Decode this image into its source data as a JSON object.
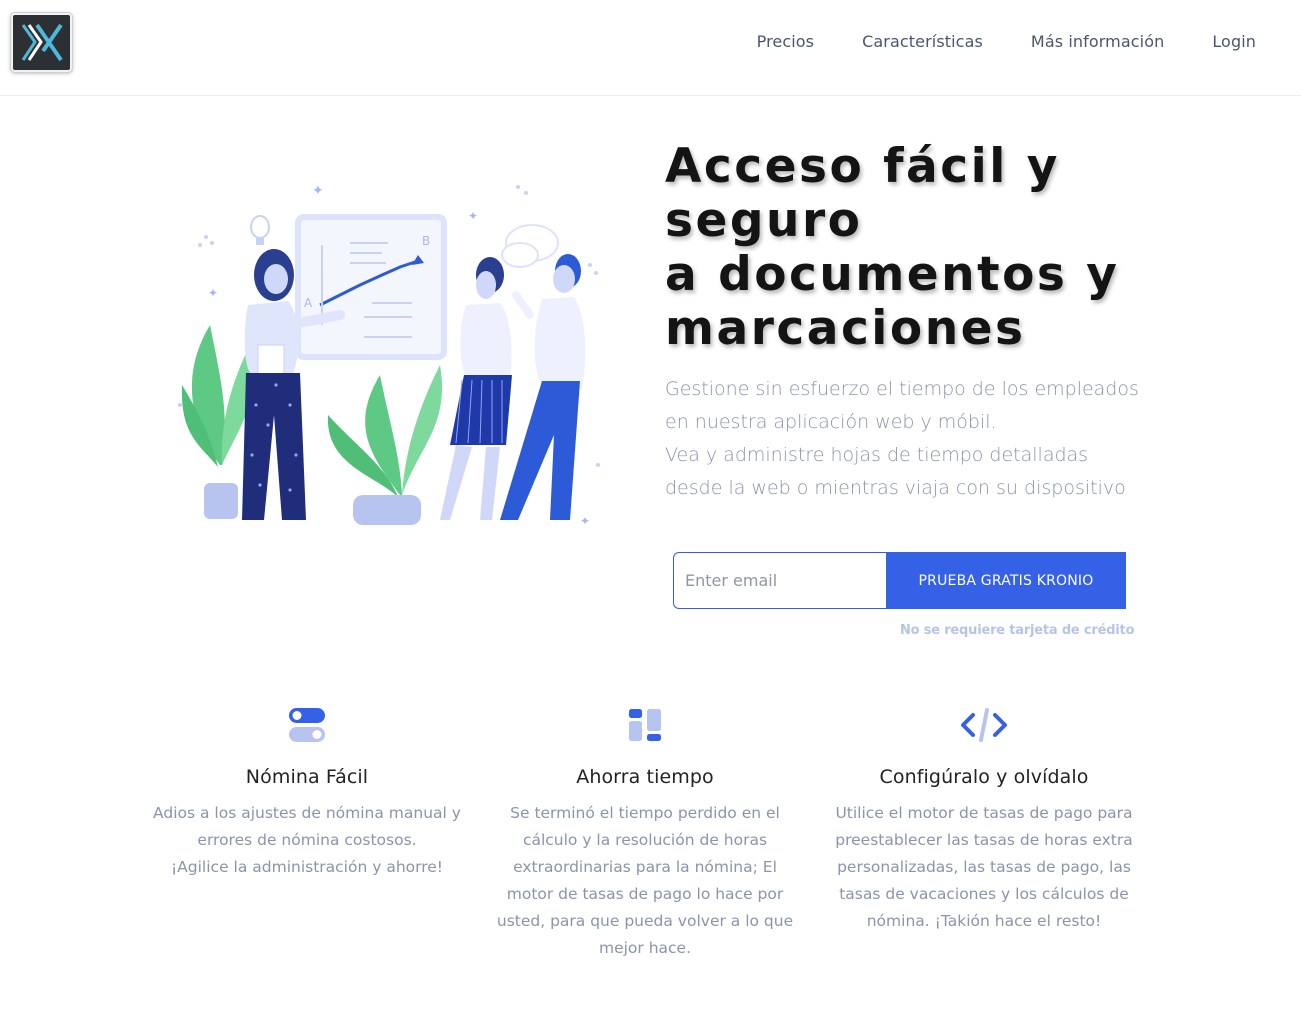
{
  "header": {
    "nav": [
      {
        "label": "Precios"
      },
      {
        "label": "Características"
      },
      {
        "label": "Más información"
      },
      {
        "label": "Login"
      }
    ]
  },
  "hero": {
    "title_lines": [
      "Acceso fácil y",
      "seguro",
      "a documentos y",
      "marcaciones"
    ],
    "subtitle_lines": [
      "Gestione sin esfuerzo el tiempo de los empleados",
      "en nuestra aplicación web y móbil.",
      "Vea y administre hojas de tiempo detalladas",
      "desde la web o mientras viaja con su dispositivo"
    ],
    "email_placeholder": "Enter email",
    "cta_label": "PRUEBA GRATIS KRONIO",
    "no_card_note": "No se requiere tarjeta de crédito"
  },
  "features": [
    {
      "icon": "toggle-icon",
      "title": "Nómina Fácil",
      "lines": [
        "Adios a los ajustes de nómina manual y",
        "errores de nómina costosos.",
        "¡Agilice la administración y ahorre!"
      ]
    },
    {
      "icon": "dashboard-icon",
      "title": "Ahorra tiempo",
      "lines": [
        "Se terminó el tiempo perdido en el",
        "cálculo y la resolución de horas",
        "extraordinarias para la nómina; El",
        "motor de tasas de pago lo hace por",
        "usted, para que pueda volver a lo que",
        "mejor hace."
      ]
    },
    {
      "icon": "code-icon",
      "title": "Configúralo y olvídalo",
      "lines": [
        "Utilice el motor de tasas de pago para",
        "preestablecer las tasas de horas extra",
        "personalizadas, las tasas de pago, las",
        "tasas de vacaciones y los cálculos de",
        "nómina. ¡Takión hace el resto!"
      ]
    }
  ],
  "colors": {
    "accent": "#3561e6",
    "accent_light": "#b8c4f0",
    "text_muted": "#8a94ac"
  }
}
